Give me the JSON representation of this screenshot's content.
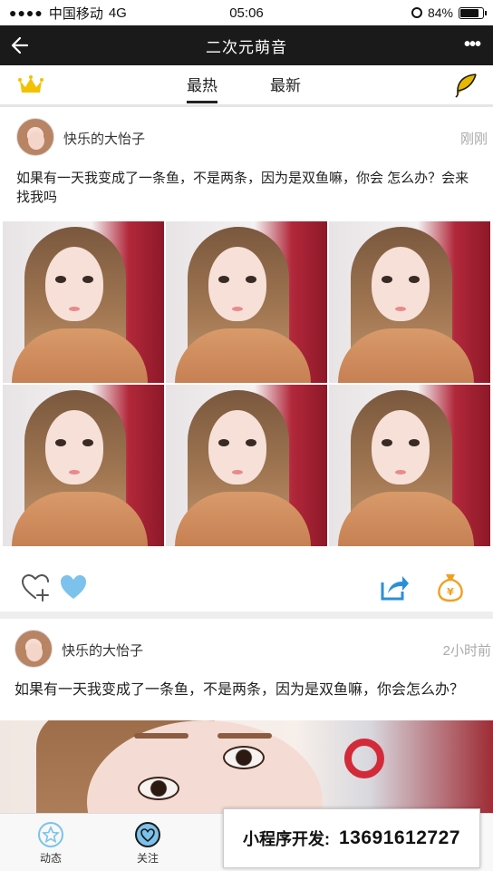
{
  "status_bar": {
    "carrier": "中国移动",
    "network": "4G",
    "time": "05:06",
    "battery": "84%",
    "battery_level": 0.84
  },
  "navbar": {
    "title": "二次元萌音",
    "more": "•••"
  },
  "tabs": [
    {
      "label": "最热",
      "active": true
    },
    {
      "label": "最新",
      "active": false
    }
  ],
  "posts": [
    {
      "username": "快乐的大怡子",
      "time": "刚刚",
      "text": "如果有一天我变成了一条鱼，不是两条，因为是双鱼嘛，你会 怎么办？会来找我吗",
      "photo_count": 6
    },
    {
      "username": "快乐的大怡子",
      "time": "2小时前",
      "text": "如果有一天我变成了一条鱼，不是两条，因为是双鱼嘛，你会怎么办？"
    }
  ],
  "bottom_tabs": [
    {
      "label": "动态"
    },
    {
      "label": "关注"
    }
  ],
  "promo": {
    "label": "小程序开发:",
    "phone": "13691612727"
  },
  "colors": {
    "navbar_bg": "#1a1a1a",
    "crown": "#f2c200",
    "leaf": "#e6b800",
    "heart": "#7cc2ec",
    "share": "#2b8fd8",
    "money_bag": "#f0a020"
  }
}
